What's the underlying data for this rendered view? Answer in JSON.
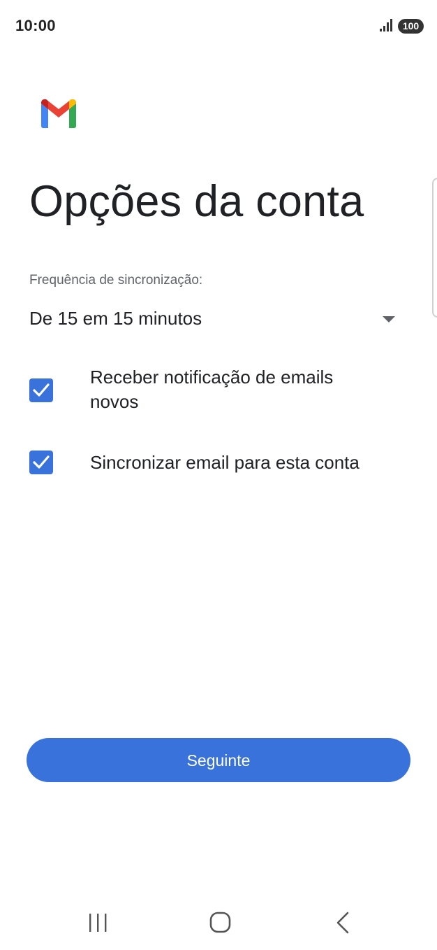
{
  "status_bar": {
    "time": "10:00",
    "battery": "100",
    "signal_icon": "signal-bars-icon"
  },
  "logo": {
    "icon": "gmail-logo-icon",
    "colors": {
      "red": "#EA4335",
      "blue": "#4285F4",
      "green": "#34A853",
      "yellow": "#FBBC04",
      "dark_red": "#C5221F"
    }
  },
  "page": {
    "title": "Opções da conta"
  },
  "sync": {
    "label": "Frequência de sincronização:",
    "value": "De 15 em 15 minutos"
  },
  "options": [
    {
      "label": "Receber notificação de emails novos",
      "checked": true
    },
    {
      "label": "Sincronizar email para esta conta",
      "checked": true
    }
  ],
  "actions": {
    "next_label": "Seguinte"
  },
  "nav_bar": {
    "recents_icon": "recents-icon",
    "home_icon": "home-icon",
    "back_icon": "back-icon"
  },
  "colors": {
    "accent": "#3A72DC",
    "text": "#202124",
    "secondary_text": "#5F6368"
  }
}
